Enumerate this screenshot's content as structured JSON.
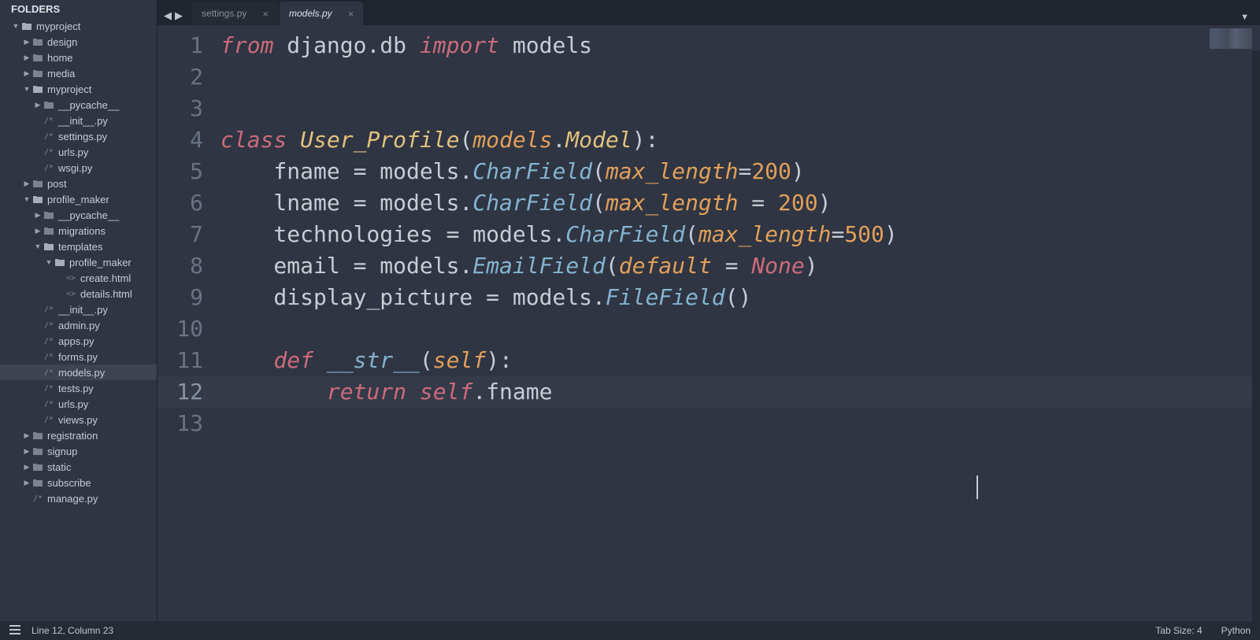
{
  "sidebar": {
    "title": "FOLDERS",
    "tree": [
      {
        "d": 0,
        "t": "folder",
        "open": true,
        "name": "myproject"
      },
      {
        "d": 1,
        "t": "folder",
        "open": false,
        "name": "design"
      },
      {
        "d": 1,
        "t": "folder",
        "open": false,
        "name": "home"
      },
      {
        "d": 1,
        "t": "folder",
        "open": false,
        "name": "media"
      },
      {
        "d": 1,
        "t": "folder",
        "open": true,
        "name": "myproject"
      },
      {
        "d": 2,
        "t": "folder",
        "open": false,
        "name": "__pycache__"
      },
      {
        "d": 2,
        "t": "py",
        "name": "__init__.py"
      },
      {
        "d": 2,
        "t": "py",
        "name": "settings.py"
      },
      {
        "d": 2,
        "t": "py",
        "name": "urls.py"
      },
      {
        "d": 2,
        "t": "py",
        "name": "wsgi.py"
      },
      {
        "d": 1,
        "t": "folder",
        "open": false,
        "name": "post"
      },
      {
        "d": 1,
        "t": "folder",
        "open": true,
        "name": "profile_maker"
      },
      {
        "d": 2,
        "t": "folder",
        "open": false,
        "name": "__pycache__"
      },
      {
        "d": 2,
        "t": "folder",
        "open": false,
        "name": "migrations"
      },
      {
        "d": 2,
        "t": "folder",
        "open": true,
        "name": "templates"
      },
      {
        "d": 3,
        "t": "folder",
        "open": true,
        "name": "profile_maker"
      },
      {
        "d": 4,
        "t": "html",
        "name": "create.html"
      },
      {
        "d": 4,
        "t": "html",
        "name": "details.html"
      },
      {
        "d": 2,
        "t": "py",
        "name": "__init__.py"
      },
      {
        "d": 2,
        "t": "py",
        "name": "admin.py"
      },
      {
        "d": 2,
        "t": "py",
        "name": "apps.py"
      },
      {
        "d": 2,
        "t": "py",
        "name": "forms.py"
      },
      {
        "d": 2,
        "t": "py",
        "name": "models.py",
        "selected": true
      },
      {
        "d": 2,
        "t": "py",
        "name": "tests.py"
      },
      {
        "d": 2,
        "t": "py",
        "name": "urls.py"
      },
      {
        "d": 2,
        "t": "py",
        "name": "views.py"
      },
      {
        "d": 1,
        "t": "folder",
        "open": false,
        "name": "registration"
      },
      {
        "d": 1,
        "t": "folder",
        "open": false,
        "name": "signup"
      },
      {
        "d": 1,
        "t": "folder",
        "open": false,
        "name": "static"
      },
      {
        "d": 1,
        "t": "folder",
        "open": false,
        "name": "subscribe"
      },
      {
        "d": 1,
        "t": "py",
        "name": "manage.py"
      }
    ]
  },
  "tabs": [
    {
      "label": "settings.py",
      "active": false
    },
    {
      "label": "models.py",
      "active": true
    }
  ],
  "code": {
    "lines": [
      [
        {
          "c": "kw",
          "s": "from"
        },
        {
          "c": "pl",
          "s": " django.db "
        },
        {
          "c": "kw",
          "s": "import"
        },
        {
          "c": "pl",
          "s": " models"
        }
      ],
      [],
      [],
      [
        {
          "c": "kw",
          "s": "class"
        },
        {
          "c": "pl",
          "s": " "
        },
        {
          "c": "cls",
          "s": "User_Profile"
        },
        {
          "c": "pl",
          "s": "("
        },
        {
          "c": "arg",
          "s": "models"
        },
        {
          "c": "pl",
          "s": "."
        },
        {
          "c": "cls",
          "s": "Model"
        },
        {
          "c": "pl",
          "s": "):"
        }
      ],
      [
        {
          "c": "pl",
          "s": "    fname = models."
        },
        {
          "c": "fn",
          "s": "CharField"
        },
        {
          "c": "pl",
          "s": "("
        },
        {
          "c": "arg",
          "s": "max_length"
        },
        {
          "c": "pl",
          "s": "="
        },
        {
          "c": "num",
          "s": "200"
        },
        {
          "c": "pl",
          "s": ")"
        }
      ],
      [
        {
          "c": "pl",
          "s": "    lname = models."
        },
        {
          "c": "fn",
          "s": "CharField"
        },
        {
          "c": "pl",
          "s": "("
        },
        {
          "c": "arg",
          "s": "max_length"
        },
        {
          "c": "pl",
          "s": " = "
        },
        {
          "c": "num",
          "s": "200"
        },
        {
          "c": "pl",
          "s": ")"
        }
      ],
      [
        {
          "c": "pl",
          "s": "    technologies = models."
        },
        {
          "c": "fn",
          "s": "CharField"
        },
        {
          "c": "pl",
          "s": "("
        },
        {
          "c": "arg",
          "s": "max_length"
        },
        {
          "c": "pl",
          "s": "="
        },
        {
          "c": "num",
          "s": "500"
        },
        {
          "c": "pl",
          "s": ")"
        }
      ],
      [
        {
          "c": "pl",
          "s": "    email = models."
        },
        {
          "c": "fn",
          "s": "EmailField"
        },
        {
          "c": "pl",
          "s": "("
        },
        {
          "c": "arg",
          "s": "default"
        },
        {
          "c": "pl",
          "s": " = "
        },
        {
          "c": "none",
          "s": "None"
        },
        {
          "c": "pl",
          "s": ")"
        }
      ],
      [
        {
          "c": "pl",
          "s": "    display_picture = models."
        },
        {
          "c": "fn",
          "s": "FileField"
        },
        {
          "c": "pl",
          "s": "()"
        }
      ],
      [],
      [
        {
          "c": "pl",
          "s": "    "
        },
        {
          "c": "kw",
          "s": "def"
        },
        {
          "c": "pl",
          "s": " "
        },
        {
          "c": "mag",
          "s": "__str__"
        },
        {
          "c": "pl",
          "s": "("
        },
        {
          "c": "arg",
          "s": "self"
        },
        {
          "c": "pl",
          "s": "):"
        }
      ],
      [
        {
          "c": "pl",
          "s": "        "
        },
        {
          "c": "kw",
          "s": "return"
        },
        {
          "c": "pl",
          "s": " "
        },
        {
          "c": "self",
          "s": "self"
        },
        {
          "c": "pl",
          "s": ".fname"
        }
      ],
      []
    ],
    "current_line": 12
  },
  "status": {
    "position": "Line 12, Column 23",
    "tab_size": "Tab Size: 4",
    "language": "Python"
  }
}
